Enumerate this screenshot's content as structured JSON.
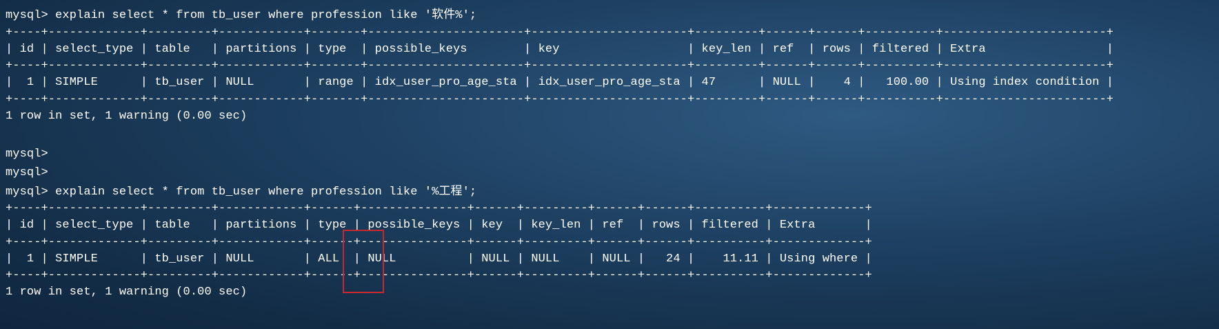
{
  "terminal": {
    "block1": {
      "command": "mysql> explain select * from tb_user where profession like '软件%';",
      "border": "+----+-------------+---------+------------+-------+----------------------+----------------------+---------+------+------+----------+-----------------------+",
      "header": "| id | select_type | table   | partitions | type  | possible_keys        | key                  | key_len | ref  | rows | filtered | Extra                 |",
      "row": "|  1 | SIMPLE      | tb_user | NULL       | range | idx_user_pro_age_sta | idx_user_pro_age_sta | 47      | NULL |    4 |   100.00 | Using index condition |",
      "summary": "1 row in set, 1 warning (0.00 sec)"
    },
    "prompt_empty_1": "mysql>",
    "prompt_empty_2": "mysql>",
    "block2": {
      "command": "mysql> explain select * from tb_user where profession like '%工程';",
      "border": "+----+-------------+---------+------------+------+---------------+------+---------+------+------+----------+-------------+",
      "header": "| id | select_type | table   | partitions | type | possible_keys | key  | key_len | ref  | rows | filtered | Extra       |",
      "row": "|  1 | SIMPLE      | tb_user | NULL       | ALL  | NULL          | NULL | NULL    | NULL |   24 |    11.11 | Using where |",
      "summary": "1 row in set, 1 warning (0.00 sec)"
    },
    "highlight_color": "#c9282e",
    "background_color": "#1d3f60"
  }
}
